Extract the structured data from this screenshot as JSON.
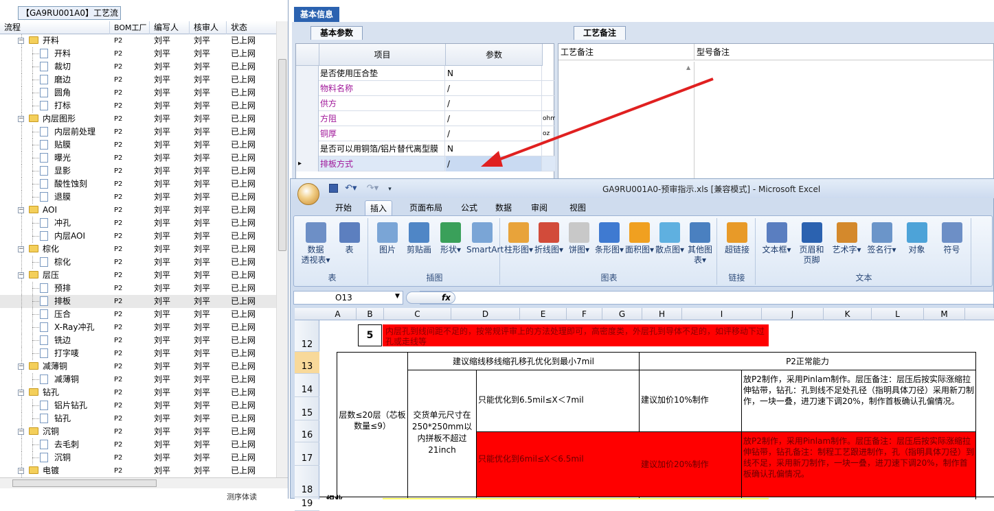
{
  "left": {
    "tab": "【GA9RU001A0】工艺流程",
    "headers": [
      "流程",
      "BOM工厂",
      "编写人",
      "核审人",
      "状态"
    ],
    "rows": [
      {
        "name": "开料",
        "level": 0,
        "bom": "P2",
        "w": "刘平",
        "r": "刘平",
        "s": "已上网"
      },
      {
        "name": "开料",
        "level": 1,
        "bom": "P2",
        "w": "刘平",
        "r": "刘平",
        "s": "已上网"
      },
      {
        "name": "裁切",
        "level": 1,
        "bom": "P2",
        "w": "刘平",
        "r": "刘平",
        "s": "已上网"
      },
      {
        "name": "磨边",
        "level": 1,
        "bom": "P2",
        "w": "刘平",
        "r": "刘平",
        "s": "已上网"
      },
      {
        "name": "圆角",
        "level": 1,
        "bom": "P2",
        "w": "刘平",
        "r": "刘平",
        "s": "已上网"
      },
      {
        "name": "打标",
        "level": 1,
        "bom": "P2",
        "w": "刘平",
        "r": "刘平",
        "s": "已上网"
      },
      {
        "name": "内层图形",
        "level": 0,
        "bom": "P2",
        "w": "刘平",
        "r": "刘平",
        "s": "已上网"
      },
      {
        "name": "内层前处理",
        "level": 1,
        "bom": "P2",
        "w": "刘平",
        "r": "刘平",
        "s": "已上网"
      },
      {
        "name": "贴膜",
        "level": 1,
        "bom": "P2",
        "w": "刘平",
        "r": "刘平",
        "s": "已上网"
      },
      {
        "name": "曝光",
        "level": 1,
        "bom": "P2",
        "w": "刘平",
        "r": "刘平",
        "s": "已上网"
      },
      {
        "name": "显影",
        "level": 1,
        "bom": "P2",
        "w": "刘平",
        "r": "刘平",
        "s": "已上网"
      },
      {
        "name": "酸性蚀刻",
        "level": 1,
        "bom": "P2",
        "w": "刘平",
        "r": "刘平",
        "s": "已上网"
      },
      {
        "name": "退膜",
        "level": 1,
        "bom": "P2",
        "w": "刘平",
        "r": "刘平",
        "s": "已上网"
      },
      {
        "name": "AOI",
        "level": 0,
        "bom": "P2",
        "w": "刘平",
        "r": "刘平",
        "s": "已上网"
      },
      {
        "name": "冲孔",
        "level": 1,
        "bom": "P2",
        "w": "刘平",
        "r": "刘平",
        "s": "已上网"
      },
      {
        "name": "内层AOI",
        "level": 1,
        "bom": "P2",
        "w": "刘平",
        "r": "刘平",
        "s": "已上网"
      },
      {
        "name": "棕化",
        "level": 0,
        "bom": "P2",
        "w": "刘平",
        "r": "刘平",
        "s": "已上网"
      },
      {
        "name": "棕化",
        "level": 1,
        "bom": "P2",
        "w": "刘平",
        "r": "刘平",
        "s": "已上网"
      },
      {
        "name": "层压",
        "level": 0,
        "bom": "P2",
        "w": "刘平",
        "r": "刘平",
        "s": "已上网"
      },
      {
        "name": "预排",
        "level": 1,
        "bom": "P2",
        "w": "刘平",
        "r": "刘平",
        "s": "已上网"
      },
      {
        "name": "排板",
        "level": 1,
        "bom": "P2",
        "w": "刘平",
        "r": "刘平",
        "s": "已上网",
        "sel": true
      },
      {
        "name": "压合",
        "level": 1,
        "bom": "P2",
        "w": "刘平",
        "r": "刘平",
        "s": "已上网"
      },
      {
        "name": "X-Ray冲孔",
        "level": 1,
        "bom": "P2",
        "w": "刘平",
        "r": "刘平",
        "s": "已上网"
      },
      {
        "name": "铣边",
        "level": 1,
        "bom": "P2",
        "w": "刘平",
        "r": "刘平",
        "s": "已上网"
      },
      {
        "name": "打字唛",
        "level": 1,
        "bom": "P2",
        "w": "刘平",
        "r": "刘平",
        "s": "已上网"
      },
      {
        "name": "减薄铜",
        "level": 0,
        "bom": "P2",
        "w": "刘平",
        "r": "刘平",
        "s": "已上网"
      },
      {
        "name": "减薄铜",
        "level": 1,
        "bom": "P2",
        "w": "刘平",
        "r": "刘平",
        "s": "已上网"
      },
      {
        "name": "钻孔",
        "level": 0,
        "bom": "P2",
        "w": "刘平",
        "r": "刘平",
        "s": "已上网"
      },
      {
        "name": "铝片钻孔",
        "level": 1,
        "bom": "P2",
        "w": "刘平",
        "r": "刘平",
        "s": "已上网"
      },
      {
        "name": "钻孔",
        "level": 1,
        "bom": "P2",
        "w": "刘平",
        "r": "刘平",
        "s": "已上网"
      },
      {
        "name": "沉铜",
        "level": 0,
        "bom": "P2",
        "w": "刘平",
        "r": "刘平",
        "s": "已上网"
      },
      {
        "name": "去毛刺",
        "level": 1,
        "bom": "P2",
        "w": "刘平",
        "r": "刘平",
        "s": "已上网"
      },
      {
        "name": "沉铜",
        "level": 1,
        "bom": "P2",
        "w": "刘平",
        "r": "刘平",
        "s": "已上网"
      },
      {
        "name": "电镀",
        "level": 0,
        "bom": "P2",
        "w": "刘平",
        "r": "刘平",
        "s": "已上网"
      }
    ],
    "footer": "测序体读"
  },
  "top": {
    "tab": "基本信息",
    "sub1": "基本参数",
    "sub2": "工艺备注",
    "grid_headers": [
      "项目",
      "参数"
    ],
    "params": [
      {
        "k": "是否使用压合垫",
        "v": "N",
        "u": "",
        "pur": false
      },
      {
        "k": "物料名称",
        "v": "/",
        "u": "",
        "pur": true
      },
      {
        "k": "供方",
        "v": "/",
        "u": "",
        "pur": true
      },
      {
        "k": "方阻",
        "v": "/",
        "u": "ohm",
        "pur": true
      },
      {
        "k": "铜厚",
        "v": "/",
        "u": "oz",
        "pur": true
      },
      {
        "k": "是否可以用铜箔/铝片替代离型膜",
        "v": "N",
        "u": "",
        "pur": false
      },
      {
        "k": "排板方式",
        "v": "/",
        "u": "",
        "pur": true,
        "sel": true
      }
    ],
    "note_headers": [
      "工艺备注",
      "型号备注"
    ]
  },
  "excel": {
    "title": "GA9RU001A0-预审指示.xls  [兼容模式] - Microsoft Excel",
    "tabs": [
      "开始",
      "插入",
      "页面布局",
      "公式",
      "数据",
      "审阅",
      "视图"
    ],
    "active_tab": "插入",
    "groups": [
      {
        "label": "表",
        "buttons": [
          "数据\n透视表▾",
          "表"
        ]
      },
      {
        "label": "插图",
        "buttons": [
          "图片",
          "剪贴画",
          "形状▾",
          "SmartArt"
        ]
      },
      {
        "label": "图表",
        "buttons": [
          "柱形图▾",
          "折线图▾",
          "饼图▾",
          "条形图▾",
          "面积图▾",
          "散点图▾",
          "其他图表▾"
        ]
      },
      {
        "label": "链接",
        "buttons": [
          "超链接"
        ]
      },
      {
        "label": "文本",
        "buttons": [
          "文本框▾",
          "页眉和\n页脚",
          "艺术字▾",
          "签名行▾",
          "对象",
          "符号"
        ]
      }
    ],
    "namebox": "O13",
    "fx": "fx",
    "cols": [
      "A",
      "B",
      "C",
      "D",
      "E",
      "F",
      "G",
      "H",
      "I",
      "J",
      "K",
      "L",
      "M"
    ],
    "rows": [
      "12",
      "13",
      "14",
      "15",
      "16",
      "17",
      "18",
      "19"
    ],
    "cells": {
      "b12": "5",
      "c12": "内层孔到线间距不足的，按常规评审上的方法处理即可，高密度类，外层孔到导体不足的，如评移动下过孔或走线等",
      "d13": "建议缩线移线缩孔移孔优化到最小7mil",
      "j13": "P2正常能力",
      "a14": "层数≤20层（芯板数量≤9）",
      "c14": "交货单元尺寸在250*250mm以内拼板不超过21inch",
      "e14": "只能优化到6.5mil≤X＜7mil",
      "h14": "建议加价10%制作",
      "j14": "放P2制作，采用Pinlam制作。层压备注：层压后按实际涨缩拉伸钻带，钻孔：孔到线不足处孔径（指明具体刀径）采用新刀制作，一块一叠，进刀速下调20%，制作首板确认孔偏情况。",
      "e17": "只能优化到6mil≤X＜6.5mil",
      "h17": "建议加价20%制作",
      "j17": "放P2制作，采用Pinlam制作。层压备注：层压后按实际涨缩拉伸钻带，钻孔备注：制程工艺跟进制作，孔（指明具体刀径）到线不足，采用新刀制作，一块一叠，进刀速下调20%，制作首板确认孔偏情况。",
      "a19": "织业"
    }
  },
  "colors": {
    "accent": "#2b62b0",
    "red": "#ff0000",
    "arrow": "#e02020",
    "purple": "#a0189a"
  }
}
